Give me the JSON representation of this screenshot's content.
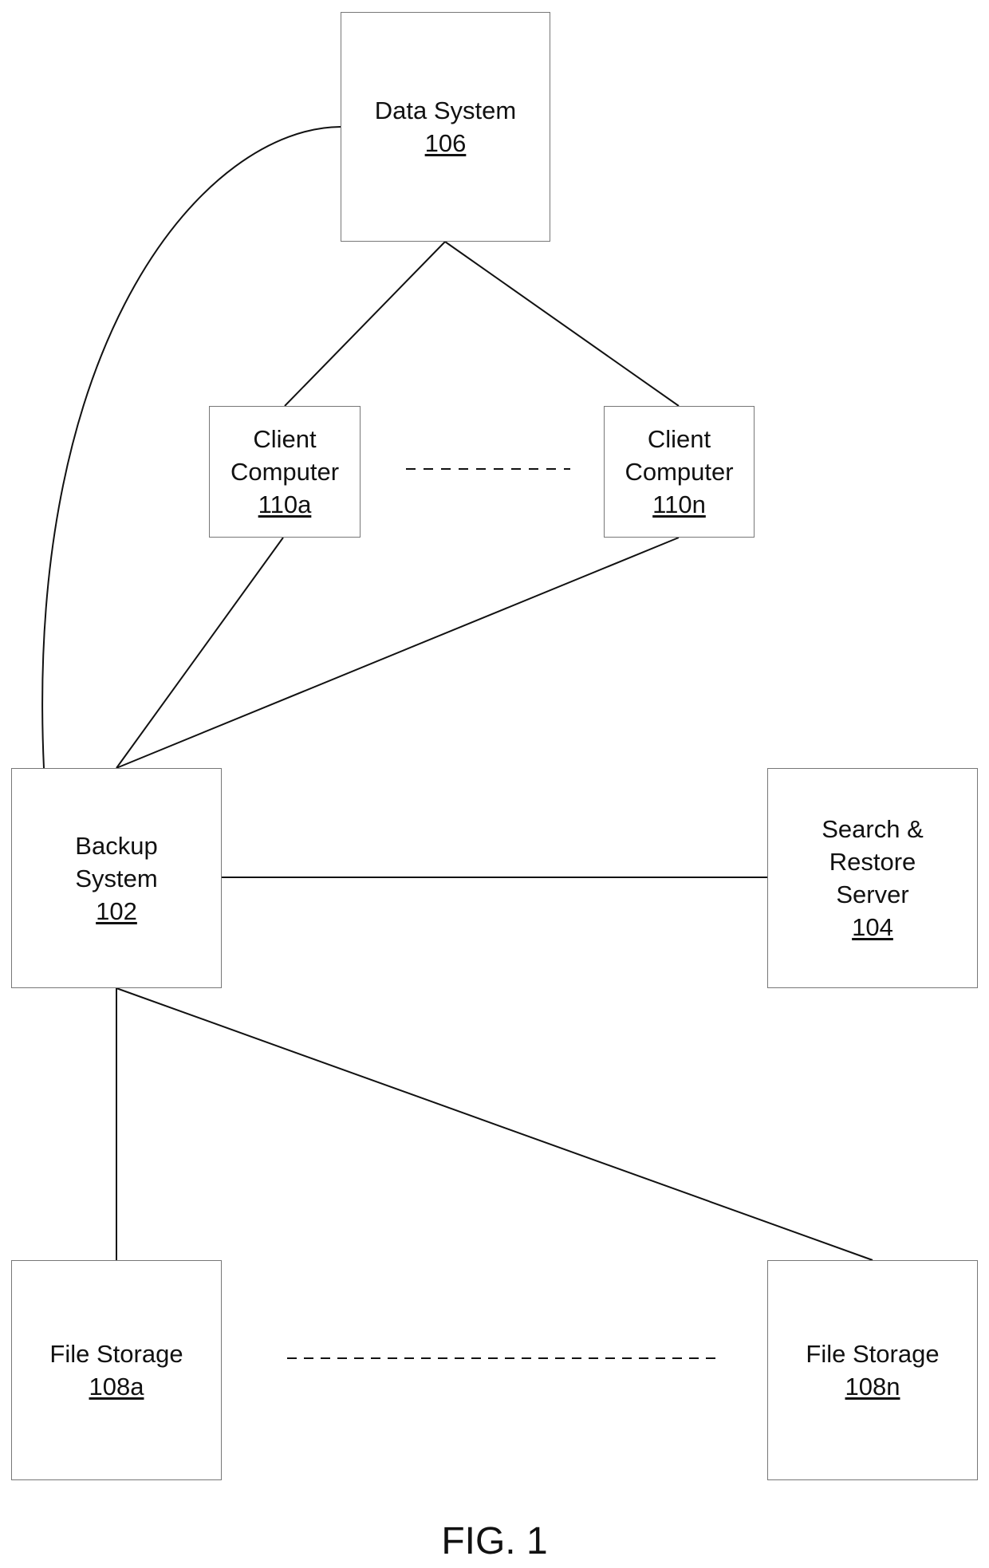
{
  "figure": {
    "caption": "FIG. 1",
    "nodes": {
      "data_system": {
        "label": "Data System",
        "ref": "106"
      },
      "client_a": {
        "label_line1": "Client",
        "label_line2": "Computer",
        "ref": "110a"
      },
      "client_n": {
        "label_line1": "Client",
        "label_line2": "Computer",
        "ref": "110n"
      },
      "backup": {
        "label_line1": "Backup",
        "label_line2": "System",
        "ref": "102"
      },
      "search": {
        "label_line1": "Search &",
        "label_line2": "Restore",
        "label_line3": "Server",
        "ref": "104"
      },
      "storage_a": {
        "label": "File Storage",
        "ref": "108a"
      },
      "storage_n": {
        "label": "File Storage",
        "ref": "108n"
      }
    },
    "connections": [
      {
        "from": "data_system",
        "to": "backup",
        "style": "curve"
      },
      {
        "from": "data_system",
        "to": "client_a",
        "style": "solid"
      },
      {
        "from": "data_system",
        "to": "client_n",
        "style": "solid"
      },
      {
        "from": "client_a",
        "to": "backup",
        "style": "solid"
      },
      {
        "from": "client_n",
        "to": "backup",
        "style": "solid"
      },
      {
        "from": "backup",
        "to": "search",
        "style": "solid"
      },
      {
        "from": "backup",
        "to": "storage_a",
        "style": "solid"
      },
      {
        "from": "backup",
        "to": "storage_n",
        "style": "solid"
      },
      {
        "from": "client_a",
        "to": "client_n",
        "style": "dashed-ellipsis"
      },
      {
        "from": "storage_a",
        "to": "storage_n",
        "style": "dashed-ellipsis"
      }
    ]
  }
}
